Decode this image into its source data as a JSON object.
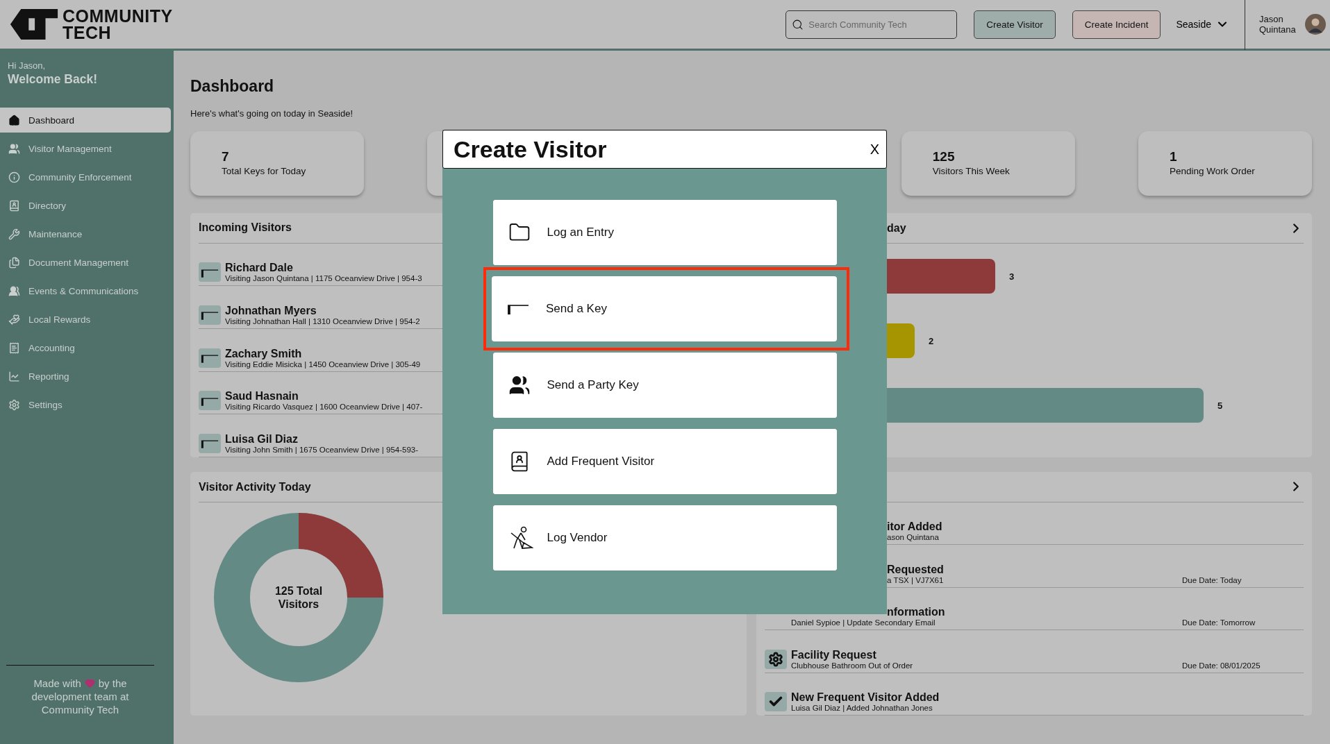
{
  "header": {
    "logo_text": "COMMUNITY TECH",
    "search": {
      "placeholder": "Search Community Tech"
    },
    "buttons": [
      {
        "label": "Create Visitor",
        "kind": "visitor"
      },
      {
        "label": "Create Incident",
        "kind": "incident"
      }
    ],
    "community": "Seaside",
    "user": "Jason Quintana"
  },
  "sidebar": {
    "greeting": "Hi Jason,",
    "welcome": "Welcome Back!",
    "items": [
      {
        "label": "Dashboard",
        "selected": true
      },
      {
        "label": "Visitor Management",
        "selected": false
      },
      {
        "label": "Community Enforcement",
        "selected": false
      },
      {
        "label": "Directory",
        "selected": false
      },
      {
        "label": "Maintenance",
        "selected": false
      },
      {
        "label": "Document Management",
        "selected": false
      },
      {
        "label": "Events & Communications",
        "selected": false
      },
      {
        "label": "Local Rewards",
        "selected": false
      },
      {
        "label": "Accounting",
        "selected": false
      },
      {
        "label": "Reporting",
        "selected": false
      },
      {
        "label": "Settings",
        "selected": false
      }
    ],
    "footer_start": "Made with",
    "footer_middle": "by the",
    "footer_end": "development team at Community Tech"
  },
  "page": {
    "title": "Dashboard",
    "subtitle": "Here's what's going on today in Seaside!"
  },
  "stats": [
    {
      "value": "7",
      "label": "Total Keys for Today"
    },
    {
      "value": "125",
      "label": "Visitors This Week"
    },
    {
      "value": "1",
      "label": "Pending Work Order"
    }
  ],
  "incoming_visitors": {
    "title": "Incoming Visitors",
    "rows": [
      {
        "name": "Richard Dale",
        "detail": "Visiting Jason Quintana | 1175 Oceanview Drive | 954-3"
      },
      {
        "name": "Johnathan Myers",
        "detail": "Visiting Johnathan Hall | 1310 Oceanview Drive | 954-2"
      },
      {
        "name": "Zachary Smith",
        "detail": "Visiting Eddie Misicka | 1450 Oceanview Drive | 305-49"
      },
      {
        "name": "Saud Hasnain",
        "detail": "Visiting Ricardo Vasquez | 1600 Oceanview Drive | 407-"
      },
      {
        "name": "Luisa Gil Diaz",
        "detail": "Visiting John Smith | 1675 Oceanview Drive | 954-593-"
      }
    ]
  },
  "bar_panel": {
    "title": "day",
    "bars": [
      {
        "value": "3",
        "color": "#8e3a3a"
      },
      {
        "value": "2",
        "color": "#a69500"
      },
      {
        "value": "5",
        "color": "#638a85"
      }
    ]
  },
  "visitor_activity": {
    "title": "Visitor Activity Today",
    "center_label": "125 Total Visitors"
  },
  "activity": {
    "rows": [
      {
        "title": "itor Added",
        "detail": "ason Quintana"
      },
      {
        "title": "Requested",
        "detail": "a TSX | VJ7X61",
        "due": "Due Date: Today"
      },
      {
        "title": "nformation",
        "detail": "Daniel Sypioe | Update Secondary Email",
        "due": "Due Date: Tomorrow"
      },
      {
        "title": "Facility Request",
        "detail": "Clubhouse Bathroom Out of Order",
        "due": "Due Date: 08/01/2025"
      },
      {
        "title": "New Frequent Visitor Added",
        "detail": "Luisa Gil Diaz | Added Johnathan Jones"
      }
    ]
  },
  "modal": {
    "title": "Create Visitor",
    "close": "X",
    "options": [
      {
        "label": "Log an Entry",
        "selected": false
      },
      {
        "label": "Send a Key",
        "selected": true
      },
      {
        "label": "Send a Party Key",
        "selected": false
      },
      {
        "label": "Add Frequent Visitor",
        "selected": false
      },
      {
        "label": "Log Vendor",
        "selected": false
      }
    ]
  }
}
